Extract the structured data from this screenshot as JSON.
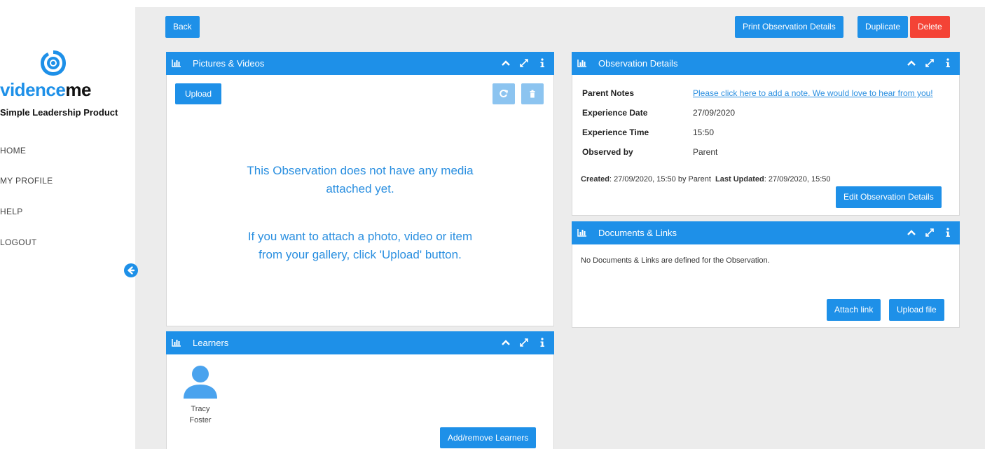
{
  "sidebar": {
    "brand_part1": "vidence",
    "brand_part2": "me",
    "tagline": "Simple Leadership Product",
    "nav": [
      "HOME",
      "MY PROFILE",
      "HELP",
      "LOGOUT"
    ]
  },
  "toolbar": {
    "back": "Back",
    "print": "Print Observation Details",
    "duplicate": "Duplicate",
    "delete": "Delete"
  },
  "media_panel": {
    "title": "Pictures & Videos",
    "upload": "Upload",
    "empty_line1": "This Observation does not have any media",
    "empty_line2": "attached yet.",
    "empty_line3": "If you want to attach a photo, video or item",
    "empty_line4": "from your gallery, click 'Upload' button."
  },
  "learners_panel": {
    "title": "Learners",
    "learner_first": "Tracy",
    "learner_last": "Foster",
    "add_remove": "Add/remove Learners"
  },
  "details_panel": {
    "title": "Observation Details",
    "rows": [
      {
        "label": "Parent Notes",
        "value": "Please click here to add a note. We would love to hear from you!"
      },
      {
        "label": "Experience Date",
        "value": "27/09/2020"
      },
      {
        "label": "Experience Time",
        "value": "15:50"
      },
      {
        "label": "Observed by",
        "value": "Parent"
      }
    ],
    "created_label": "Created",
    "created_value": ": 27/09/2020, 15:50 by Parent",
    "updated_label": "Last Updated",
    "updated_value": ": 27/09/2020, 15:50",
    "edit": "Edit Observation Details"
  },
  "docs_panel": {
    "title": "Documents & Links",
    "empty": "No Documents & Links are defined for the Observation.",
    "attach": "Attach link",
    "upload": "Upload file"
  },
  "colors": {
    "accent": "#1e90e8",
    "danger": "#f44336",
    "background": "#ececec"
  },
  "icons": [
    "logo-eye-icon",
    "arrow-left-circle-icon",
    "bar-chart-icon",
    "chevron-up-icon",
    "expand-icon",
    "info-icon",
    "refresh-icon",
    "trash-icon",
    "user-avatar-icon"
  ]
}
